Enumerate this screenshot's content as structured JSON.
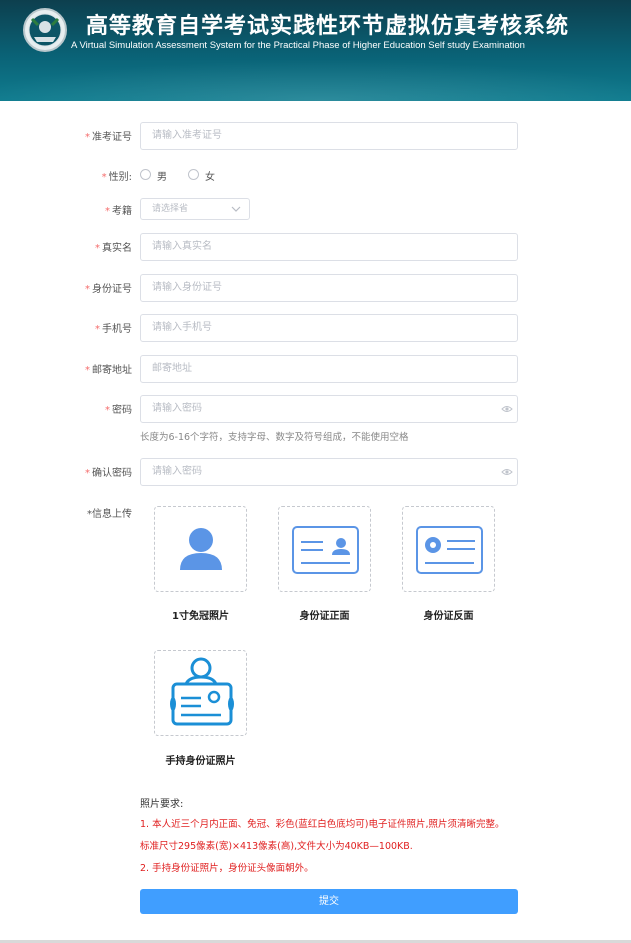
{
  "header": {
    "title_cn": "高等教育自学考试实践性环节虚拟仿真考核系统",
    "title_en": "A Virtual Simulation Assessment System for the Practical Phase of Higher Education Self study Examination"
  },
  "form": {
    "required_mark": "*",
    "exam_id": {
      "label": "准考证号",
      "placeholder": "请输入准考证号"
    },
    "gender": {
      "label": "性别:",
      "options": [
        "男",
        "女"
      ]
    },
    "province": {
      "label": "考籍",
      "placeholder": "请选择省"
    },
    "real_name": {
      "label": "真实名",
      "placeholder": "请输入真实名"
    },
    "id_number": {
      "label": "身份证号",
      "placeholder": "请输入身份证号"
    },
    "phone": {
      "label": "手机号",
      "placeholder": "请输入手机号"
    },
    "address": {
      "label": "邮寄地址",
      "placeholder": "邮寄地址"
    },
    "password": {
      "label": "密码",
      "placeholder": "请输入密码",
      "hint": "长度为6-16个字符，支持字母、数字及符号组成，不能使用空格"
    },
    "confirm_password": {
      "label": "确认密码",
      "placeholder": "请输入密码"
    },
    "upload": {
      "label": "*信息上传",
      "items": [
        "1寸免冠照片",
        "身份证正面",
        "身份证反面",
        "手持身份证照片"
      ]
    }
  },
  "photo_requirements": {
    "title": "照片要求:",
    "lines": [
      "1. 本人近三个月内正面、免冠、彩色(蓝红白色底均可)电子证件照片,照片须清晰完整。",
      "标准尺寸295像素(宽)×413像素(高),文件大小为40KB—100KB.",
      "2. 手持身份证照片，身份证头像面朝外。"
    ]
  },
  "submit_label": "提交",
  "colors": {
    "accent": "#409eff",
    "header": "#0a6276",
    "required": "#f56c6c",
    "warning_text": "#e02020",
    "icon_blue": "#5b95e6"
  },
  "icons": [
    "emblem-logo",
    "eye-icon",
    "chevron-down-icon",
    "person-icon",
    "id-card-front-icon",
    "id-card-back-icon",
    "person-holding-id-icon"
  ]
}
